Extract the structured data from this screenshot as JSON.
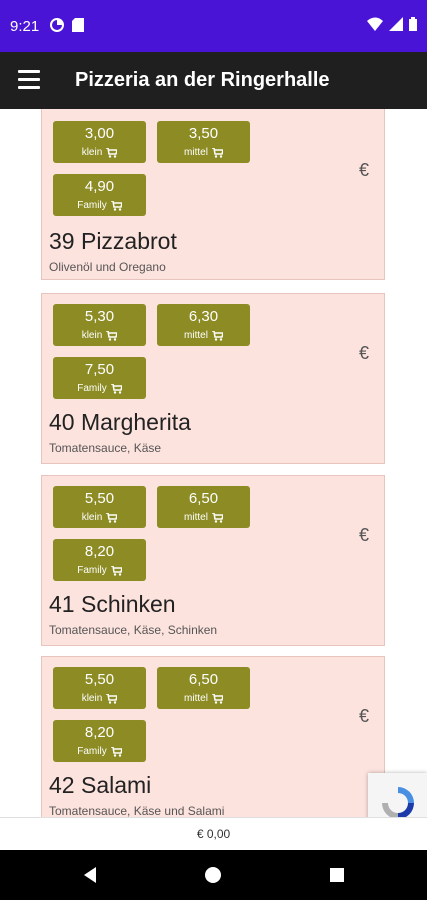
{
  "status_bar": {
    "time": "9:21"
  },
  "app_bar": {
    "title": "Pizzeria an der Ringerhalle"
  },
  "items": [
    {
      "title": "",
      "description": "",
      "currency": "€",
      "prices": [
        {
          "value": "3,00",
          "size": "klein"
        },
        {
          "value": "3,50",
          "size": "mittel"
        },
        {
          "value": "4,90",
          "size": "Family"
        }
      ]
    },
    {
      "title": "39 Pizzabrot",
      "description": "Olivenöl und Oregano",
      "currency": "€",
      "prices": [
        {
          "value": "5,30",
          "size": "klein"
        },
        {
          "value": "6,30",
          "size": "mittel"
        },
        {
          "value": "7,50",
          "size": "Family"
        }
      ]
    },
    {
      "title": "40 Margherita",
      "description": "Tomatensauce, Käse",
      "currency": "€",
      "prices": [
        {
          "value": "5,50",
          "size": "klein"
        },
        {
          "value": "6,50",
          "size": "mittel"
        },
        {
          "value": "8,20",
          "size": "Family"
        }
      ]
    },
    {
      "title": "41 Schinken",
      "description": "Tomatensauce, Käse, Schinken",
      "currency": "€",
      "prices": [
        {
          "value": "5,50",
          "size": "klein"
        },
        {
          "value": "6,50",
          "size": "mittel"
        },
        {
          "value": "8,20",
          "size": "Family"
        }
      ]
    },
    {
      "title": "42 Salami",
      "description": "Tomatensauce, Käse und Salami",
      "currency": "€",
      "prices": []
    }
  ],
  "footer": {
    "total": "€ 0,00"
  },
  "colors": {
    "status_bar": "#4a14d6",
    "app_bar": "#1f1f1f",
    "card_bg": "#fde3de",
    "price_button": "#8c8b24"
  }
}
